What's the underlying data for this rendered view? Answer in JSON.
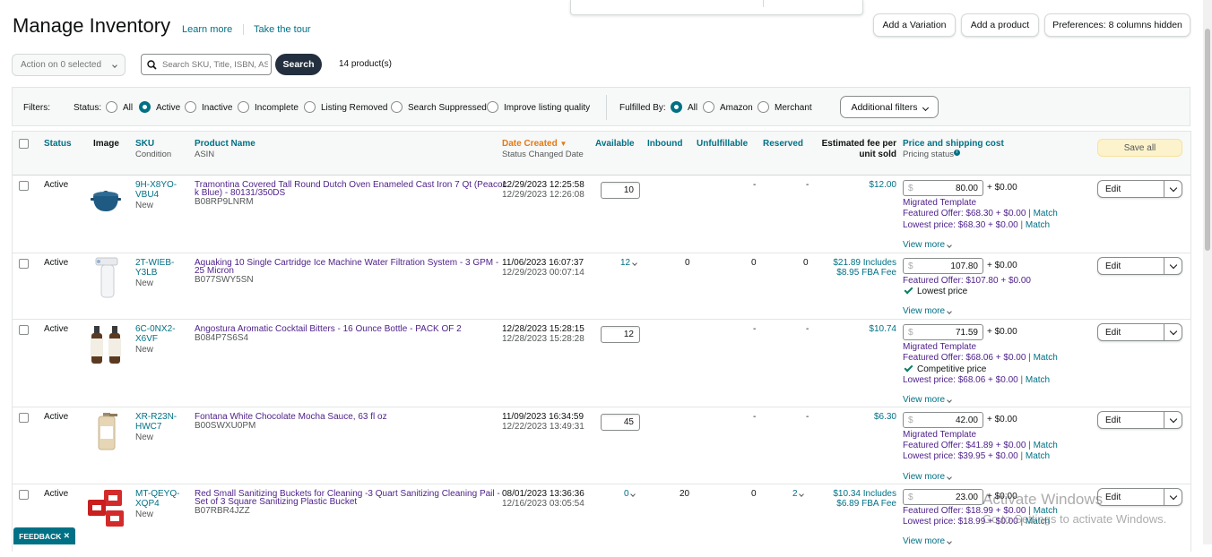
{
  "page": {
    "title": "Manage Inventory",
    "learn_more": "Learn more",
    "take_tour": "Take the tour"
  },
  "toolbar": {
    "add_variation": "Add a Variation",
    "add_product": "Add a product",
    "preferences": "Preferences: 8 columns hidden",
    "action_select": "Action on 0 selected",
    "search_placeholder": "Search SKU, Title, ISBN, ASIN",
    "search_button": "Search",
    "product_count": "14 product(s)"
  },
  "filters": {
    "label": "Filters:",
    "status_label": "Status:",
    "status_options": [
      "All",
      "Active",
      "Inactive",
      "Incomplete",
      "Listing Removed",
      "Search Suppressed",
      "Improve listing quality"
    ],
    "status_selected": "Active",
    "fulfilled_label": "Fulfilled By:",
    "fulfilled_options": [
      "All",
      "Amazon",
      "Merchant"
    ],
    "fulfilled_selected": "All",
    "additional": "Additional filters"
  },
  "columns": {
    "status": "Status",
    "image": "Image",
    "sku": "SKU",
    "sku_sub": "Condition",
    "name": "Product Name",
    "name_sub": "ASIN",
    "date": "Date Created",
    "date_sub": "Status Changed Date",
    "available": "Available",
    "inbound": "Inbound",
    "unfulfillable": "Unfulfillable",
    "reserved": "Reserved",
    "fee": "Estimated fee per unit sold",
    "price": "Price and shipping cost",
    "price_sub": "Pricing status",
    "save_all": "Save all"
  },
  "rows": [
    {
      "status": "Active",
      "sku1": "9H-X8YO-",
      "sku2": "VBU4",
      "condition": "New",
      "name1": "Tramontina Covered Tall Round Dutch Oven Enameled Cast Iron 7 Qt (Peacoc",
      "name2": "k Blue) - 80131/350DS",
      "asin": "B08RP9LNRM",
      "date1": "12/29/2023 12:25:58",
      "date2": "12/29/2023 12:26:08",
      "available": "10",
      "inbound": "",
      "unfulfillable": "-",
      "reserved": "-",
      "fee1": "$12.00",
      "fee2": "",
      "price": "80.00",
      "shipping": "+ $0.00",
      "lines": [
        "Migrated Template",
        "Featured Offer: $68.30 + $0.00",
        "Lowest price: $68.30 + $0.00"
      ],
      "view_more": "View more",
      "edit": "Edit"
    },
    {
      "status": "Active",
      "sku1": "2T-WIEB-",
      "sku2": "Y3LB",
      "condition": "New",
      "name1": "Aquaking 10 Single Cartridge Ice Machine Water Filtration System - 3 GPM -",
      "name2": "25 Micron",
      "asin": "B077SWY5SN",
      "date1": "11/06/2023 16:07:37",
      "date2": "12/29/2023 00:07:14",
      "available": "12",
      "inbound": "0",
      "unfulfillable": "0",
      "reserved": "0",
      "fee1": "$21.89 Includes",
      "fee2": "$8.95 FBA Fee",
      "price": "107.80",
      "shipping": "+ $0.00",
      "lines": [
        "Featured Offer: $107.80 + $0.00",
        "Lowest price"
      ],
      "view_more": "View more",
      "edit": "Edit"
    },
    {
      "status": "Active",
      "sku1": "6C-0NX2-",
      "sku2": "X6VF",
      "condition": "New",
      "name1": "Angostura Aromatic Cocktail Bitters - 16 Ounce Bottle - PACK OF 2",
      "name2": "",
      "asin": "B084P7S6S4",
      "date1": "12/28/2023 15:28:15",
      "date2": "12/28/2023 15:28:28",
      "available": "12",
      "inbound": "",
      "unfulfillable": "-",
      "reserved": "-",
      "fee1": "$10.74",
      "fee2": "",
      "price": "71.59",
      "shipping": "+ $0.00",
      "lines": [
        "Migrated Template",
        "Featured Offer: $68.06 + $0.00",
        "Competitive price",
        "Lowest price: $68.06 + $0.00"
      ],
      "view_more": "View more",
      "edit": "Edit"
    },
    {
      "status": "Active",
      "sku1": "XR-R23N-",
      "sku2": "HWC7",
      "condition": "New",
      "name1": "Fontana White Chocolate Mocha Sauce, 63 fl oz",
      "name2": "",
      "asin": "B00SWXU0PM",
      "date1": "11/09/2023 16:34:59",
      "date2": "12/22/2023 13:49:31",
      "available": "45",
      "inbound": "",
      "unfulfillable": "-",
      "reserved": "-",
      "fee1": "$6.30",
      "fee2": "",
      "price": "42.00",
      "shipping": "+ $0.00",
      "lines": [
        "Migrated Template",
        "Featured Offer: $41.89 + $0.00",
        "Lowest price: $39.95 + $0.00"
      ],
      "view_more": "View more",
      "edit": "Edit"
    },
    {
      "status": "Active",
      "sku1": "MT-QEYQ-",
      "sku2": "XQP4",
      "condition": "New",
      "name1": "Red Small Sanitizing Buckets for Cleaning -3 Quart Sanitizing Cleaning Pail -",
      "name2": "Set of 3 Square Sanitizing Plastic Bucket",
      "asin": "B07RBR4JZZ",
      "date1": "08/01/2023 13:36:36",
      "date2": "12/16/2023 03:05:54",
      "available": "0",
      "inbound": "20",
      "unfulfillable": "0",
      "reserved": "2",
      "fee1": "$10.34 Includes",
      "fee2": "$6.89 FBA Fee",
      "price": "23.00",
      "shipping": "+ $0.00",
      "lines": [
        "Featured Offer: $18.99 + $0.00",
        "Lowest price: $18.99 + $0.00"
      ],
      "view_more": "View more",
      "edit": "Edit"
    }
  ],
  "match": "Match",
  "feedback": "FEEDBACK",
  "watermark1": "Activate Windows",
  "watermark2": "Go to Settings to activate Windows."
}
